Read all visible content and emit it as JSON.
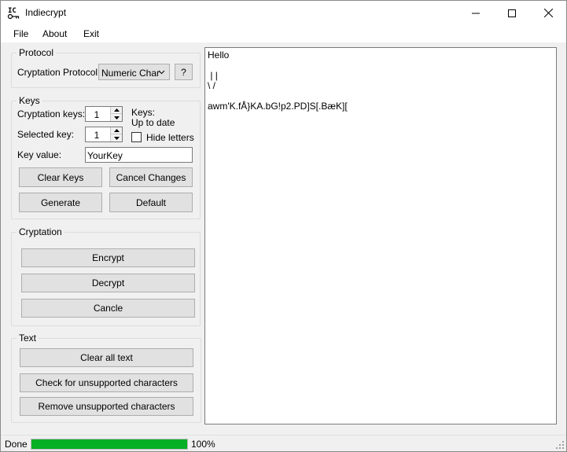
{
  "window": {
    "title": "Indiecrypt"
  },
  "menu": [
    "File",
    "About",
    "Exit"
  ],
  "protocol": {
    "group_title": "Protocol",
    "label": "Cryptation Protocol:",
    "selected": "Numeric Char",
    "help_label": "?"
  },
  "keys": {
    "group_title": "Keys",
    "cryptation_keys_label": "Cryptation keys:",
    "cryptation_keys_value": "1",
    "selected_key_label": "Selected key:",
    "selected_key_value": "1",
    "status_title": "Keys:",
    "status_value": "Up to date",
    "hide_letters_label": "Hide letters",
    "hide_letters_checked": false,
    "key_value_label": "Key value:",
    "key_value": "YourKey",
    "clear_keys_label": "Clear Keys",
    "cancel_changes_label": "Cancel Changes",
    "generate_label": "Generate",
    "default_label": "Default"
  },
  "cryptation": {
    "group_title": "Cryptation",
    "encrypt_label": "Encrypt",
    "decrypt_label": "Decrypt",
    "cancel_label": "Cancle"
  },
  "text": {
    "group_title": "Text",
    "clear_all_label": "Clear all text",
    "check_label": "Check for unsupported characters",
    "remove_label": "Remove unsupported characters"
  },
  "editor": {
    "lines": [
      "Hello",
      "",
      " | |",
      "\\ /",
      "",
      "awm'K.fÅ}KA.bG!p2.PD]S[.BæK]["
    ]
  },
  "status": {
    "text": "Done",
    "progress": 1.0,
    "progress_text": "100%"
  },
  "colors": {
    "progress": "#06b025"
  }
}
